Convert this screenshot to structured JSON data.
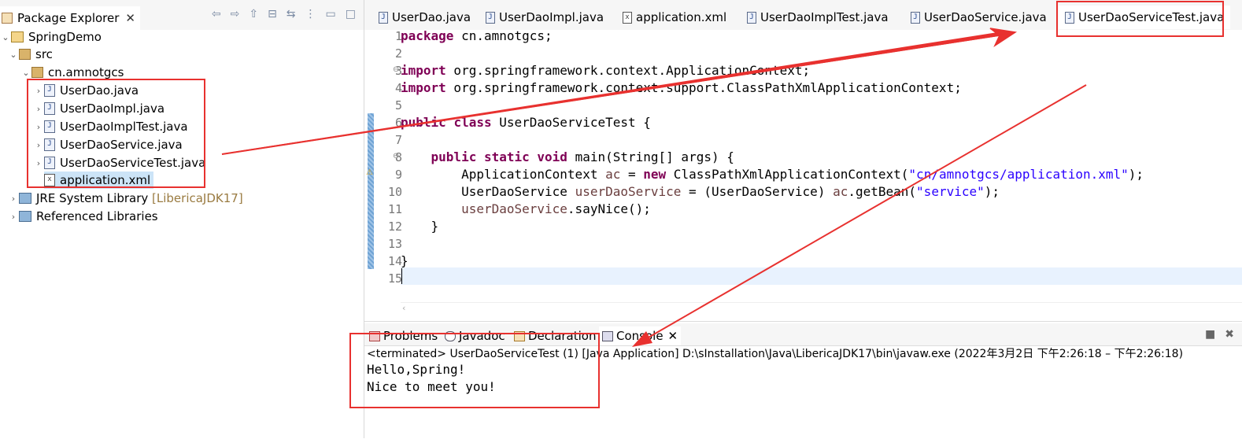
{
  "explorer": {
    "title": "Package Explorer",
    "close": "✕",
    "tree": {
      "project": "SpringDemo",
      "src": "src",
      "package": "cn.amnotgcs",
      "files": [
        "UserDao.java",
        "UserDaoImpl.java",
        "UserDaoImplTest.java",
        "UserDaoService.java",
        "UserDaoServiceTest.java",
        "application.xml"
      ],
      "jre": "JRE System Library",
      "jre_suffix": "[LibericaJDK17]",
      "ref_libs": "Referenced Libraries"
    }
  },
  "editor": {
    "tabs": [
      "UserDao.java",
      "UserDaoImpl.java",
      "application.xml",
      "UserDaoImplTest.java",
      "UserDaoService.java",
      "UserDaoServiceTest.java"
    ],
    "active_tab": "UserDaoServiceTest.java",
    "line_numbers": [
      "1",
      "2",
      "3",
      "4",
      "5",
      "6",
      "7",
      "8",
      "9",
      "10",
      "11",
      "12",
      "13",
      "14",
      "15"
    ],
    "code": {
      "l1_kw": "package",
      "l1_rest": " cn.amnotgcs;",
      "l3_kw": "import",
      "l3_rest": " org.springframework.context.ApplicationContext;",
      "l4_kw": "import",
      "l4_rest": " org.springframework.context.support.ClassPathXmlApplicationContext;",
      "l6_kw1": "public",
      "l6_kw2": "class",
      "l6_rest": " UserDaoServiceTest {",
      "l8_kw1": "public",
      "l8_kw2": "static",
      "l8_kw3": "void",
      "l8_rest": " main(String[] args) {",
      "l9_a": "ApplicationContext ",
      "l9_var": "ac",
      "l9_b": " = ",
      "l9_kw": "new",
      "l9_c": " ClassPathXmlApplicationContext(",
      "l9_str": "\"cn/amnotgcs/application.xml\"",
      "l9_d": ");",
      "l10_a": "UserDaoService ",
      "l10_var": "userDaoService",
      "l10_b": " = (UserDaoService) ",
      "l10_var2": "ac",
      "l10_c": ".getBean(",
      "l10_str": "\"service\"",
      "l10_d": ");",
      "l11_var": "userDaoService",
      "l11_rest": ".sayNice();",
      "l12": "}",
      "l14": "}"
    }
  },
  "console": {
    "tabs": [
      "Problems",
      "Javadoc",
      "Declaration",
      "Console"
    ],
    "active_tab": "Console",
    "status": "<terminated> UserDaoServiceTest (1) [Java Application] D:\\sInstallation\\Java\\LibericaJDK17\\bin\\javaw.exe  (2022年3月2日 下午2:26:18 – 下午2:26:18)",
    "output": [
      "Hello,Spring!",
      "Nice to meet you!"
    ]
  },
  "annotation_color": "#e8312f"
}
